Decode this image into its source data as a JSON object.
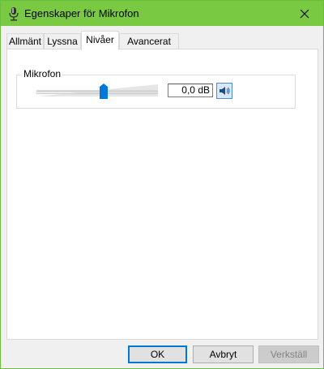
{
  "window": {
    "title": "Egenskaper för Mikrofon"
  },
  "tabs": [
    {
      "label": "Allmänt"
    },
    {
      "label": "Lyssna"
    },
    {
      "label": "Nivåer",
      "active": true
    },
    {
      "label": "Avancerat"
    }
  ],
  "levels": {
    "group_label": "Mikrofon",
    "volume_level_percent": 55,
    "db_value": "0,0 dB",
    "mute_icon": "speaker-icon"
  },
  "buttons": {
    "ok": "OK",
    "cancel": "Avbryt",
    "apply": "Verkställ"
  },
  "colors": {
    "titlebar": "#7ac943",
    "accent": "#0078d7"
  }
}
